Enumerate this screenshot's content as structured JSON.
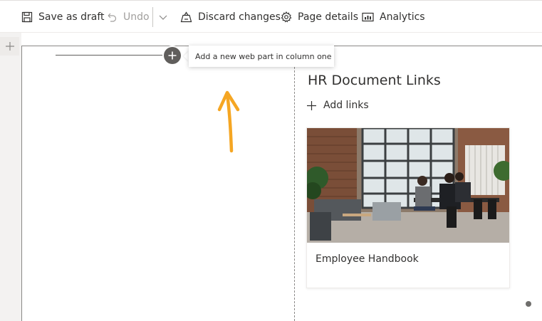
{
  "toolbar": {
    "save_draft": "Save as draft",
    "undo": "Undo",
    "discard": "Discard changes",
    "page_details": "Page details",
    "analytics": "Analytics"
  },
  "canvas": {
    "tooltip": "Add a new web part in column one"
  },
  "links_part": {
    "title": "HR Document Links",
    "add_links": "Add links",
    "card_title": "Employee Handbook"
  },
  "colors": {
    "arrow": "#f5a623",
    "plus_circle": "#605e5c"
  }
}
